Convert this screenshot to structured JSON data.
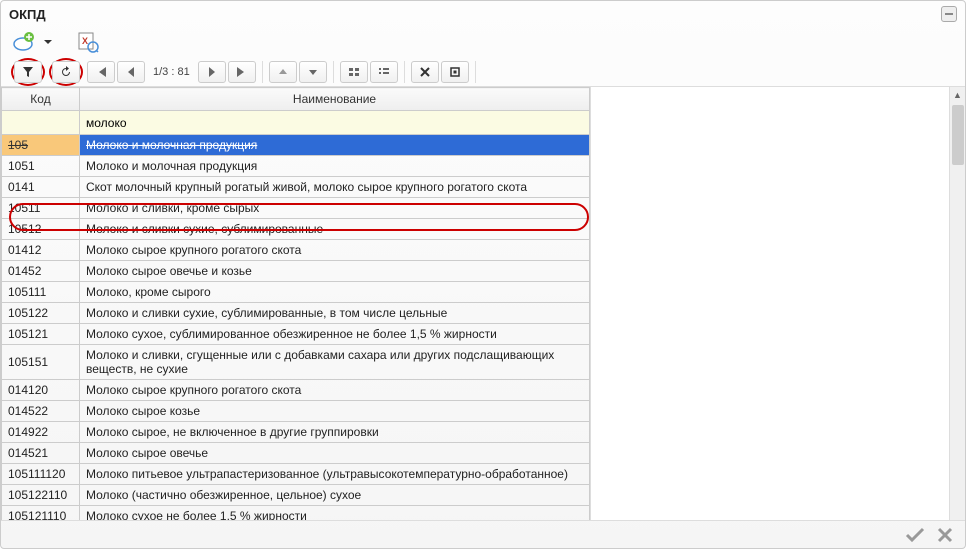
{
  "window": {
    "title": "ОКПД"
  },
  "toolbar2": {
    "page_label": "1/3 : 81"
  },
  "grid": {
    "headers": {
      "code": "Код",
      "name": "Наименование"
    },
    "filter": {
      "code": "",
      "name": "молоко"
    },
    "rows": [
      {
        "code": "105",
        "name": "Молоко и молочная продукция",
        "selected": true
      },
      {
        "code": "1051",
        "name": "Молоко и молочная продукция"
      },
      {
        "code": "0141",
        "name": "Скот молочный крупный рогатый живой, молоко сырое крупного рогатого скота"
      },
      {
        "code": "10511",
        "name": "Молоко и сливки, кроме сырых"
      },
      {
        "code": "10512",
        "name": "Молоко и сливки сухие, сублимированные"
      },
      {
        "code": "01412",
        "name": "Молоко сырое крупного рогатого скота"
      },
      {
        "code": "01452",
        "name": "Молоко сырое овечье и козье"
      },
      {
        "code": "105111",
        "name": "Молоко, кроме сырого"
      },
      {
        "code": "105122",
        "name": "Молоко и сливки сухие, сублимированные, в том числе цельные"
      },
      {
        "code": "105121",
        "name": "Молоко сухое, сублимированное обезжиренное не более 1,5 % жирности"
      },
      {
        "code": "105151",
        "name": "Молоко и сливки, сгущенные или с добавками сахара или других подслащивающих веществ, не сухие"
      },
      {
        "code": "014120",
        "name": "Молоко сырое крупного рогатого скота"
      },
      {
        "code": "014522",
        "name": "Молоко сырое козье"
      },
      {
        "code": "014922",
        "name": "Молоко сырое, не включенное в другие группировки"
      },
      {
        "code": "014521",
        "name": "Молоко сырое овечье"
      },
      {
        "code": "105111120",
        "name": "Молоко питьевое ультрапастеризованное (ультравысокотемпературно-обработанное)"
      },
      {
        "code": "105122110",
        "name": "Молоко (частично обезжиренное, цельное) сухое"
      },
      {
        "code": "105121110",
        "name": "Молоко сухое не более 1,5 % жирности"
      }
    ]
  }
}
